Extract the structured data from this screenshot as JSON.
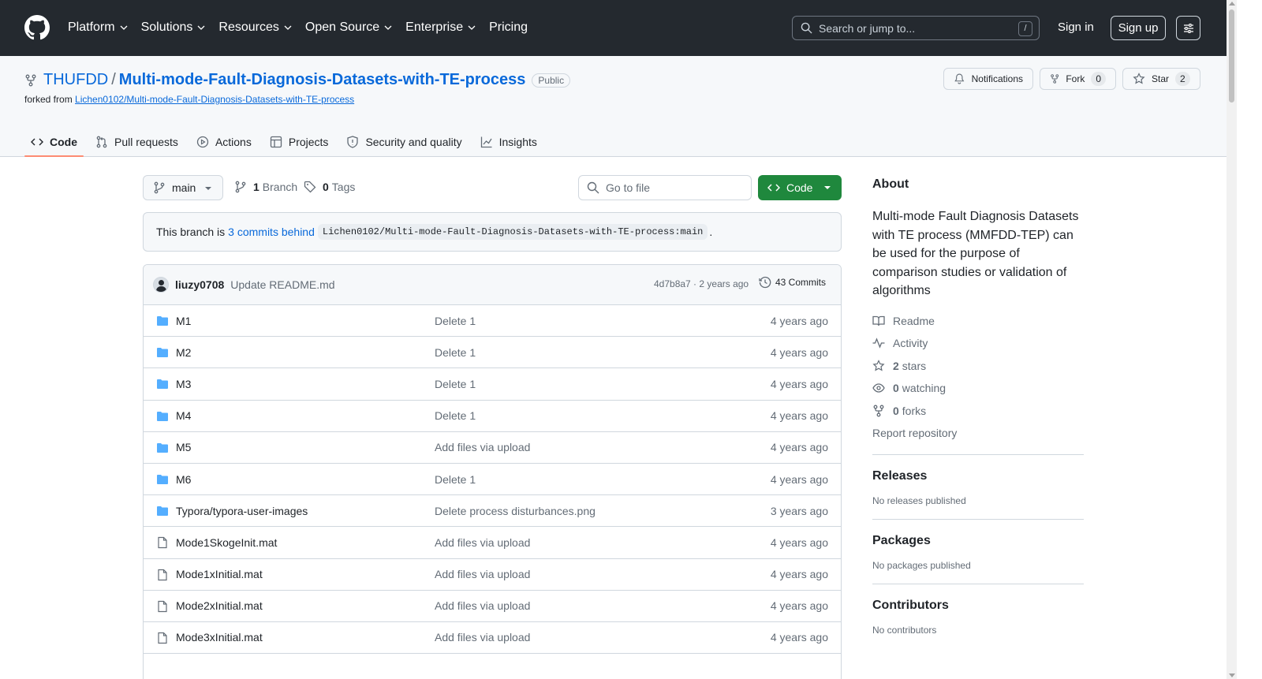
{
  "header": {
    "nav": [
      "Platform",
      "Solutions",
      "Resources",
      "Open Source",
      "Enterprise",
      "Pricing"
    ],
    "search_placeholder": "Search or jump to...",
    "search_shortcut": "/",
    "sign_in": "Sign in",
    "sign_up": "Sign up"
  },
  "repo": {
    "owner": "THUFDD",
    "separator": "/",
    "name": "Multi-mode-Fault-Diagnosis-Datasets-with-TE-process",
    "visibility": "Public",
    "forked_from_label": "forked from",
    "forked_from": "Lichen0102/Multi-mode-Fault-Diagnosis-Datasets-with-TE-process",
    "notifications_label": "Notifications",
    "fork_label": "Fork",
    "fork_count": "0",
    "star_label": "Star",
    "star_count": "2"
  },
  "tabs": [
    "Code",
    "Pull requests",
    "Actions",
    "Projects",
    "Security and quality",
    "Insights"
  ],
  "toolbar": {
    "branch": "main",
    "branch_count": "1",
    "branch_label": "Branch",
    "tag_count": "0",
    "tag_label": "Tags",
    "go_to_file": "Go to file",
    "code_button": "Code"
  },
  "behind": {
    "prefix": "This branch is",
    "link": "3 commits behind",
    "ref": "Lichen0102/Multi-mode-Fault-Diagnosis-Datasets-with-TE-process:main",
    "suffix": "."
  },
  "latest_commit": {
    "author": "liuzy0708",
    "message": "Update README.md",
    "meta": "4d7b8a7 · 2 years ago",
    "commits": "43 Commits"
  },
  "files": [
    {
      "type": "folder",
      "name": "M1",
      "message": "Delete 1",
      "age": "4 years ago"
    },
    {
      "type": "folder",
      "name": "M2",
      "message": "Delete 1",
      "age": "4 years ago"
    },
    {
      "type": "folder",
      "name": "M3",
      "message": "Delete 1",
      "age": "4 years ago"
    },
    {
      "type": "folder",
      "name": "M4",
      "message": "Delete 1",
      "age": "4 years ago"
    },
    {
      "type": "folder",
      "name": "M5",
      "message": "Add files via upload",
      "age": "4 years ago"
    },
    {
      "type": "folder",
      "name": "M6",
      "message": "Delete 1",
      "age": "4 years ago"
    },
    {
      "type": "folder",
      "name": "Typora/typora-user-images",
      "message": "Delete process disturbances.png",
      "age": "3 years ago"
    },
    {
      "type": "file",
      "name": "Mode1SkogeInit.mat",
      "message": "Add files via upload",
      "age": "4 years ago"
    },
    {
      "type": "file",
      "name": "Mode1xInitial.mat",
      "message": "Add files via upload",
      "age": "4 years ago"
    },
    {
      "type": "file",
      "name": "Mode2xInitial.mat",
      "message": "Add files via upload",
      "age": "4 years ago"
    },
    {
      "type": "file",
      "name": "Mode3xInitial.mat",
      "message": "Add files via upload",
      "age": "4 years ago"
    }
  ],
  "about": {
    "heading": "About",
    "description": "Multi-mode Fault Diagnosis Datasets with TE process (MMFDD-TEP) can be used for the purpose of comparison studies or validation of algorithms",
    "readme": "Readme",
    "activity": "Activity",
    "stars_count": "2",
    "stars_label": "stars",
    "watching_count": "0",
    "watching_label": "watching",
    "forks_count": "0",
    "forks_label": "forks",
    "report": "Report repository"
  },
  "releases": {
    "heading": "Releases",
    "note": "No releases published"
  },
  "packages": {
    "heading": "Packages",
    "note": "No packages published"
  },
  "contributors": {
    "heading": "Contributors",
    "note": "No contributors"
  },
  "colors": {
    "header_bg": "#24292f",
    "link": "#0969da",
    "primary_btn": "#1f883d",
    "tab_underline": "#fd8c73",
    "folder_icon": "#54aeff"
  }
}
